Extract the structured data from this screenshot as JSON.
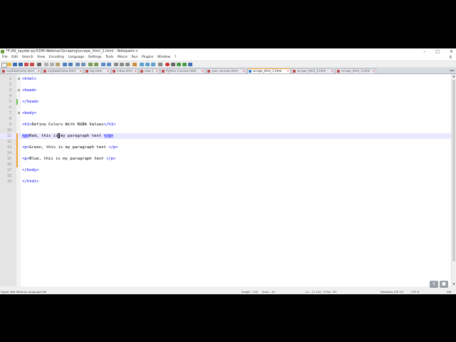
{
  "window": {
    "title": "*F:\\All_spyder-py3\\DM-Webinar\\Scraping\\scrape_html_1.html - Notepad++",
    "controls": [
      "–",
      "□",
      "✕"
    ]
  },
  "menu": [
    "File",
    "Edit",
    "Search",
    "View",
    "Encoding",
    "Language",
    "Settings",
    "Tools",
    "Macro",
    "Run",
    "Plugins",
    "Window",
    "?"
  ],
  "menu_close": "X",
  "tabs": [
    {
      "label": "myDataframe.html"
    },
    {
      "label": "myDataframe.html"
    },
    {
      "label": "top.html"
    },
    {
      "label": "index.html"
    },
    {
      "label": "new 1"
    },
    {
      "label": "Python Courses.html"
    },
    {
      "label": "your courses.html"
    },
    {
      "label": "scrape_html_1.html",
      "active": true
    },
    {
      "label": "scrape_html_2.html"
    },
    {
      "label": "scrape_html_3.html"
    }
  ],
  "tab_scroll": "◄ ►",
  "editor": {
    "current_line": 11,
    "lines": [
      {
        "n": "1",
        "parts": [
          {
            "t": "<html>",
            "c": "tag"
          }
        ]
      },
      {
        "n": "2",
        "parts": []
      },
      {
        "n": "3",
        "parts": [
          {
            "t": "<head>",
            "c": "tag"
          }
        ]
      },
      {
        "n": "4",
        "parts": []
      },
      {
        "n": "5",
        "parts": [
          {
            "t": "</head>",
            "c": "tag"
          }
        ]
      },
      {
        "n": "6",
        "parts": []
      },
      {
        "n": "7",
        "parts": [
          {
            "t": "<body>",
            "c": "tag"
          }
        ]
      },
      {
        "n": "8",
        "parts": []
      },
      {
        "n": "9",
        "parts": [
          {
            "t": "<h1>",
            "c": "tag"
          },
          {
            "t": "Define Colors With RGBA Values",
            "c": ""
          },
          {
            "t": "</h1>",
            "c": "tag"
          }
        ]
      },
      {
        "n": "10",
        "parts": []
      },
      {
        "n": "11",
        "parts": [
          {
            "t": "<p>",
            "c": "tag sel"
          },
          {
            "t": "Red, this is my paragraph text ",
            "c": ""
          },
          {
            "t": "</p>",
            "c": "tag sel"
          }
        ]
      },
      {
        "n": "12",
        "parts": []
      },
      {
        "n": "13",
        "parts": [
          {
            "t": "<p>",
            "c": "tag"
          },
          {
            "t": "Green, this is my paragraph text ",
            "c": ""
          },
          {
            "t": "</p>",
            "c": "tag"
          }
        ]
      },
      {
        "n": "14",
        "parts": []
      },
      {
        "n": "15",
        "parts": [
          {
            "t": "<p>",
            "c": "tag"
          },
          {
            "t": "Blue, this is my paragraph text ",
            "c": ""
          },
          {
            "t": "</p>",
            "c": "tag"
          }
        ]
      },
      {
        "n": "16",
        "parts": []
      },
      {
        "n": "17",
        "parts": [
          {
            "t": "</body>",
            "c": "tag"
          }
        ]
      },
      {
        "n": "18",
        "parts": []
      },
      {
        "n": "19",
        "parts": [
          {
            "t": "</html>",
            "c": "tag"
          }
        ]
      }
    ]
  },
  "status": {
    "filetype": "Hyper Text Markup Language file",
    "length": "length : 232",
    "lines": "lines : 19",
    "position": "Ln : 11    Col : 2    Pos : 87",
    "eol": "Windows (CR LF)",
    "encoding": "UTF-8",
    "mode": "INS"
  },
  "overlay": {
    "pause": "II",
    "stop": "■"
  },
  "colors": {
    "tag": "#0000ff",
    "selection": "#c0c0ff",
    "current_line": "#e8e8ff",
    "active_tab_border": "#f7a43a"
  }
}
